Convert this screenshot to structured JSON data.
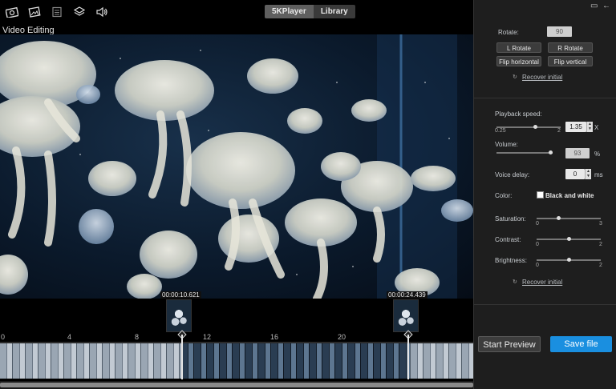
{
  "header": {
    "tabs": [
      "5KPlayer",
      "Library"
    ],
    "active_tab": "5KPlayer",
    "icons": [
      "screenshot-icon",
      "photo-icon",
      "list-icon",
      "layers-icon",
      "volume-icon"
    ]
  },
  "title": "Video Editing",
  "timeline": {
    "start_timecode": "00:00:10.621",
    "end_timecode": "00:00:24.439",
    "ruler_labels": [
      "0",
      "4",
      "8",
      "12",
      "16",
      "20"
    ]
  },
  "panel": {
    "rotate_label": "Rotate:",
    "rotate_value": "90",
    "l_rotate": "L Rotate",
    "r_rotate": "R Rotate",
    "flip_h": "Flip horizontal",
    "flip_v": "Flip vertical",
    "recover1": "Recover initial",
    "speed_label": "Playback speed:",
    "speed_min": "0.25",
    "speed_max": "2",
    "speed_value": "1.35",
    "speed_unit": "X",
    "volume_label": "Volume:",
    "volume_value": "93",
    "volume_unit": "%",
    "delay_label": "Voice delay:",
    "delay_value": "0",
    "delay_unit": "ms",
    "color_label": "Color:",
    "bw_label": "Black and white",
    "saturation_label": "Saturation:",
    "saturation_min": "0",
    "saturation_max": "3",
    "contrast_label": "Contrast:",
    "contrast_min": "0",
    "contrast_max": "2",
    "brightness_label": "Brightness:",
    "brightness_min": "0",
    "brightness_max": "2",
    "recover2": "Recover initial",
    "start_preview": "Start Preview",
    "save_file": "Save file",
    "accent": "#1a8fe0"
  }
}
